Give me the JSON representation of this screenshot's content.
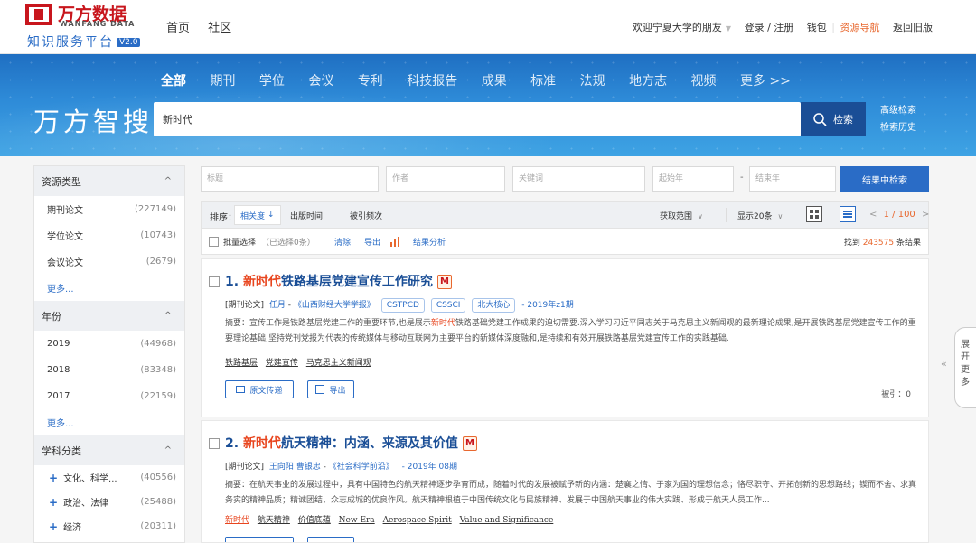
{
  "header": {
    "logo_title": "万方数据",
    "logo_sub": "WANFANG DATA",
    "platform": "知识服务平台",
    "version": "V2.0",
    "nav": [
      "首页",
      "社区"
    ],
    "welcome": "欢迎宁夏大学的朋友",
    "login": "登录 / 注册",
    "wallet": "钱包",
    "resource_nav": "资源导航",
    "old_version": "返回旧版"
  },
  "search": {
    "brand": "万方智搜",
    "categories": [
      "全部",
      "期刊",
      "学位",
      "会议",
      "专利",
      "科技报告",
      "成果",
      "标准",
      "法规",
      "地方志",
      "视频",
      "更多 >>"
    ],
    "query": "新时代",
    "button": "检索",
    "advanced": "高级检索",
    "history": "检索历史"
  },
  "sidebar": {
    "groups": [
      {
        "title": "资源类型",
        "items": [
          {
            "label": "期刊论文",
            "count": "(227149)"
          },
          {
            "label": "学位论文",
            "count": "(10743)"
          },
          {
            "label": "会议论文",
            "count": "(2679)"
          }
        ],
        "more": "更多..."
      },
      {
        "title": "年份",
        "items": [
          {
            "label": "2019",
            "count": "(44968)"
          },
          {
            "label": "2018",
            "count": "(83348)"
          },
          {
            "label": "2017",
            "count": "(22159)"
          }
        ],
        "more": "更多..."
      },
      {
        "title": "学科分类",
        "items": [
          {
            "label": "文化、科学...",
            "count": "(40556)"
          },
          {
            "label": "政治、法律",
            "count": "(25488)"
          },
          {
            "label": "经济",
            "count": "(20311)"
          }
        ]
      }
    ]
  },
  "filters": {
    "title_ph": "标题",
    "author_ph": "作者",
    "keyword_ph": "关键词",
    "start_ph": "起始年",
    "end_ph": "结束年",
    "dash": "-",
    "button": "结果中检索"
  },
  "sortbar": {
    "label": "排序：",
    "options": [
      "相关度",
      "出版时间",
      "被引频次"
    ],
    "range": "获取范围",
    "per_page": "显示20条",
    "page_current": "1",
    "page_total": "100",
    "page_sep": "/",
    "prev": "<",
    "next": ">"
  },
  "batchbar": {
    "select": "批量选择",
    "selected": "（已选择0条）",
    "clear": "清除",
    "export": "导出",
    "analysis": "结果分析",
    "found_pre": "找到",
    "found_count": "243575",
    "found_post": "条结果"
  },
  "results": [
    {
      "index": "1.",
      "title_hl": "新时代",
      "title_rest": "铁路基层党建宣传工作研究",
      "badge": "M",
      "type": "[期刊论文]",
      "author": "任月",
      "journal": "《山西财经大学学报》",
      "tags": [
        "CSTPCD",
        "CSSCI",
        "北大核心"
      ],
      "issue": "- 2019年z1期",
      "abs_pre": "摘要：宣传工作是铁路基层党建工作的重要环节,也是展示",
      "abs_hl": "新时代",
      "abs_post": "铁路基础党建工作成果的迫切需要.深入学习习近平同志关于马克思主义新闻观的最新理论成果,是开展铁路基层党建宣传工作的重要理论基础;坚持党刊党报为代表的传统媒体与移动互联网为主要平台的新媒体深度融和,是持续和有效开展铁路基层党建宣传工作的实践基础.",
      "keywords": [
        "铁路基层",
        "党建宣传",
        "马克思主义新闻观"
      ],
      "btn_fulltext": "原文传递",
      "btn_export": "导出",
      "cited": "被引：0"
    },
    {
      "index": "2.",
      "title_hl": "新时代",
      "title_rest": "航天精神：内涵、来源及其价值",
      "badge": "M",
      "type": "[期刊论文]",
      "author": "王向阳 曹银忠",
      "journal": "《社会科学前沿》",
      "issue": "- 2019年 08期",
      "abs_text": "摘要：在航天事业的发展过程中，具有中国特色的航天精神逐步孕育而成，随着时代的发展被赋予新的内涵：楚襄之情、于家为国的理想信念；恪尽职守、开拓创新的思想路线；锲而不舍、求真务实的精神品质；精诚团结、众志成城的优良作风。航天精神根植于中国传统文化与民族精神、发展于中国航天事业的伟大实践、形成于航天人员工作...",
      "keywords": [
        "新时代",
        "航天精神",
        "价值底蕴",
        "New Era",
        "Aerospace Spirit",
        "Value and Significance"
      ]
    }
  ],
  "expand_tab": {
    "label": "展开更多",
    "arrow": "«"
  },
  "colors": {
    "primary": "#2a6cc6",
    "brand_red": "#c8161d",
    "highlight": "#e8451e",
    "accent_orange": "#e8682f",
    "dark_blue": "#1a4e96"
  }
}
